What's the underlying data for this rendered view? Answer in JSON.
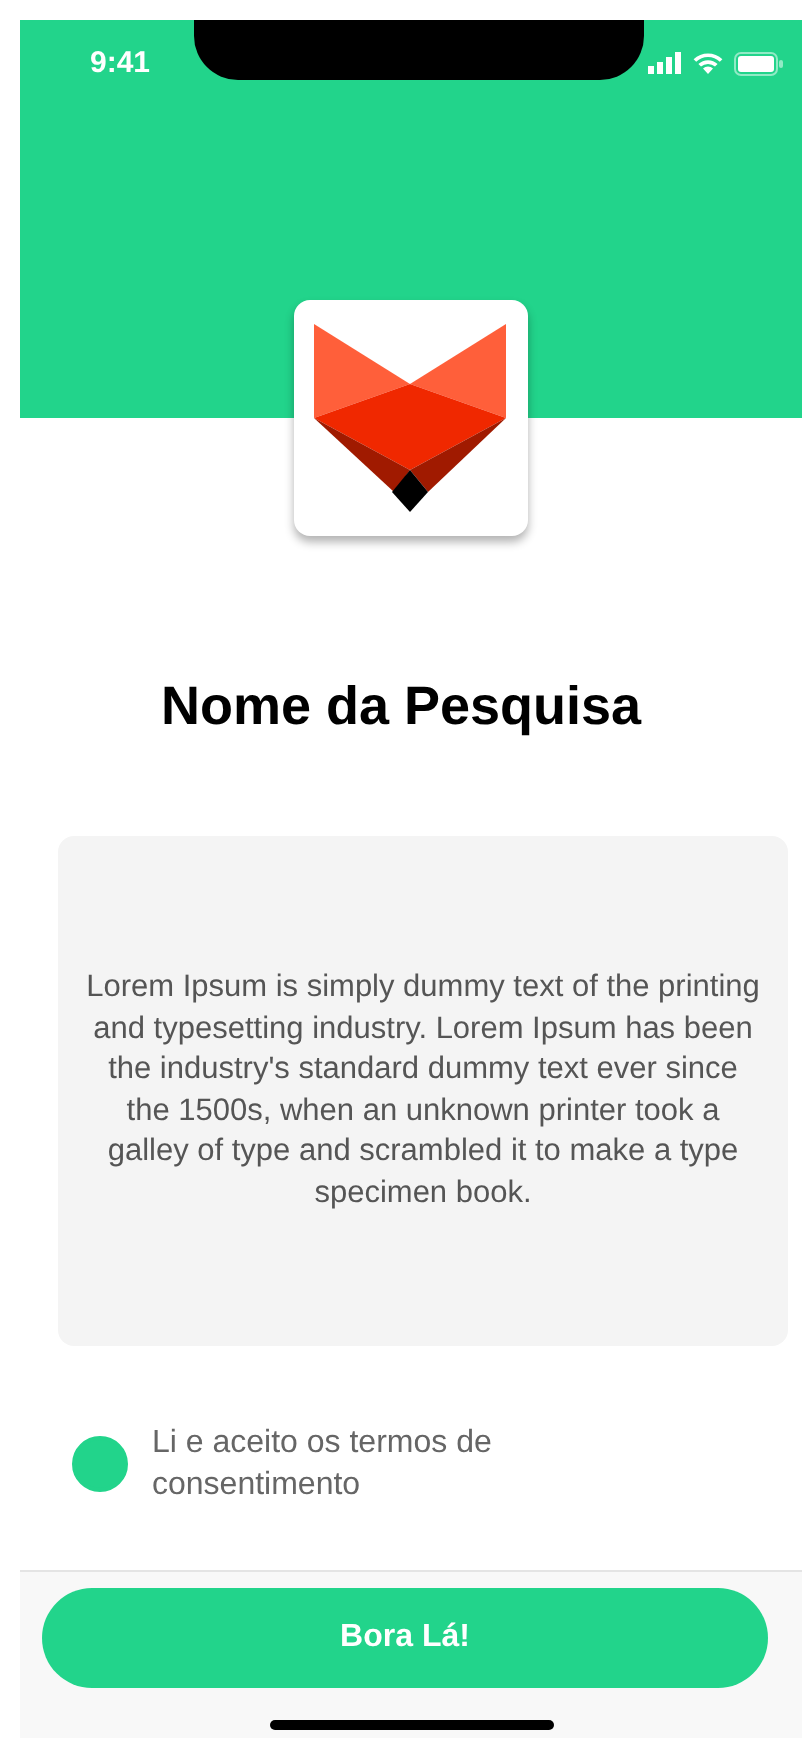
{
  "status_bar": {
    "time": "9:41"
  },
  "title": "Nome da Pesquisa",
  "description": "Lorem Ipsum is simply dummy text of the printing and typesetting industry. Lorem Ipsum has been the industry's standard dummy text ever since the 1500s, when an unknown printer took a galley of type and scrambled it to make a type specimen book.",
  "consent": {
    "label": "Li e aceito os termos de consentimento",
    "checked": true
  },
  "button": {
    "label": "Bora Lá!"
  }
}
